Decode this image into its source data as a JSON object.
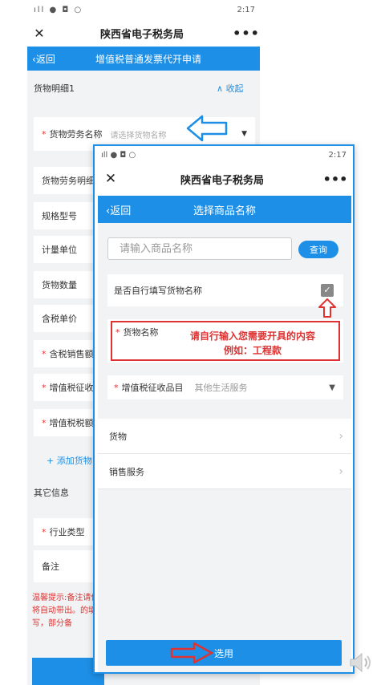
{
  "background_screen": {
    "status_time": "2:17",
    "window_title": "陕西省电子税务局",
    "back_label": "返回",
    "page_title": "增值税普通发票代开申请",
    "section_title": "货物明细1",
    "collapse_label": "收起",
    "rows": [
      {
        "label": "货物劳务名称",
        "required": true,
        "placeholder": "请选择货物名称"
      },
      {
        "label": "货物劳务明细",
        "required": false
      },
      {
        "label": "规格型号",
        "required": false
      },
      {
        "label": "计量单位",
        "required": false
      },
      {
        "label": "货物数量",
        "required": false
      },
      {
        "label": "含税单价",
        "required": false
      },
      {
        "label": "含税销售额",
        "required": true
      },
      {
        "label": "增值税征收率",
        "required": true
      },
      {
        "label": "增值税税额",
        "required": true
      }
    ],
    "add_link": "添加货物",
    "other_section": "其它信息",
    "other_rows": [
      {
        "label": "行业类型",
        "required": true
      },
      {
        "label": "备注",
        "required": false
      }
    ],
    "tip_text": "温馨提示:备注请件将自动带出。的填写，部分备"
  },
  "foreground_screen": {
    "status_time": "2:17",
    "window_title": "陕西省电子税务局",
    "back_label": "返回",
    "page_title": "选择商品名称",
    "search": {
      "placeholder": "请输入商品名称",
      "button": "查询"
    },
    "self_fill_label": "是否自行填写货物名称",
    "goods_name_label": "货物名称",
    "annotation_line1": "请自行输入您需要开具的内容",
    "annotation_line2": "例如：工程款",
    "tax_item_label": "增值税征收品目",
    "tax_item_value": "其他生活服务",
    "list_items": [
      {
        "label": "货物"
      },
      {
        "label": "销售服务"
      }
    ],
    "use_button": "选用"
  },
  "colors": {
    "primary": "#1e8fe6",
    "annotation_red": "#d33"
  }
}
